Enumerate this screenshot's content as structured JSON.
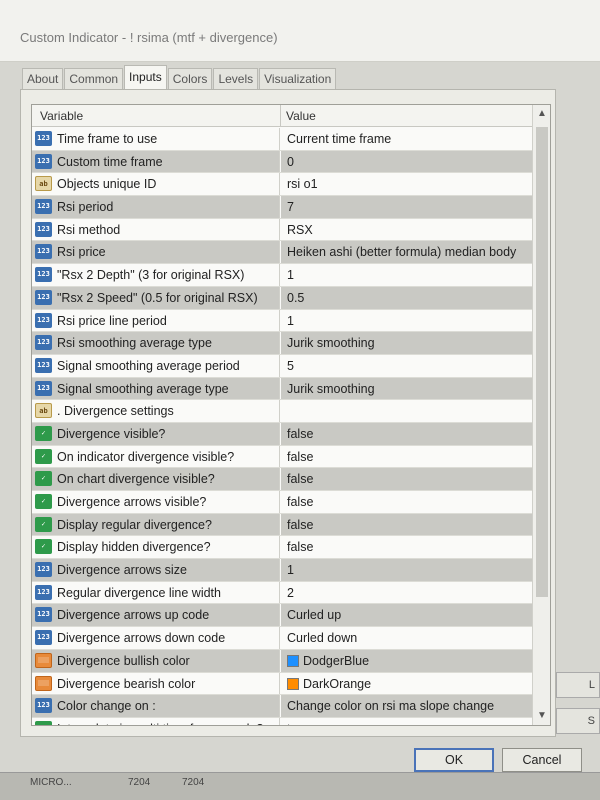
{
  "window": {
    "title": "Custom Indicator - ! rsima (mtf + divergence)"
  },
  "tabs": [
    {
      "label": "About"
    },
    {
      "label": "Common"
    },
    {
      "label": "Inputs"
    },
    {
      "label": "Colors"
    },
    {
      "label": "Levels"
    },
    {
      "label": "Visualization"
    }
  ],
  "grid": {
    "col_variable": "Variable",
    "col_value": "Value",
    "rows": [
      {
        "icon": "num",
        "variable": "Time frame to use",
        "value": "Current time frame",
        "highlight": false
      },
      {
        "icon": "num",
        "variable": "Custom time frame",
        "value": "0",
        "highlight": true
      },
      {
        "icon": "ab",
        "variable": "Objects unique ID",
        "value": "rsi o1",
        "highlight": false
      },
      {
        "icon": "num",
        "variable": "Rsi period",
        "value": "7",
        "highlight": true
      },
      {
        "icon": "num",
        "variable": "Rsi method",
        "value": "RSX",
        "highlight": false
      },
      {
        "icon": "num",
        "variable": "Rsi price",
        "value": "Heiken ashi (better formula) median body",
        "highlight": true
      },
      {
        "icon": "num",
        "variable": "\"Rsx 2 Depth\" (3 for original RSX)",
        "value": "1",
        "highlight": false
      },
      {
        "icon": "num",
        "variable": "\"Rsx 2 Speed\" (0.5 for original RSX)",
        "value": "0.5",
        "highlight": true
      },
      {
        "icon": "num",
        "variable": "Rsi price line period",
        "value": "1",
        "highlight": false
      },
      {
        "icon": "num",
        "variable": "Rsi smoothing average type",
        "value": "Jurik smoothing",
        "highlight": true
      },
      {
        "icon": "num",
        "variable": "Signal smoothing average period",
        "value": "5",
        "highlight": false
      },
      {
        "icon": "num",
        "variable": "Signal smoothing average type",
        "value": "Jurik smoothing",
        "highlight": true
      },
      {
        "icon": "ab",
        "variable": ". Divergence settings",
        "value": "",
        "highlight": false
      },
      {
        "icon": "bool",
        "variable": "Divergence visible?",
        "value": "false",
        "highlight": true
      },
      {
        "icon": "bool",
        "variable": "On indicator divergence visible?",
        "value": "false",
        "highlight": false
      },
      {
        "icon": "bool",
        "variable": "On chart divergence visible?",
        "value": "false",
        "highlight": true
      },
      {
        "icon": "bool",
        "variable": "Divergence arrows visible?",
        "value": "false",
        "highlight": false
      },
      {
        "icon": "bool",
        "variable": "Display regular divergence?",
        "value": "false",
        "highlight": true
      },
      {
        "icon": "bool",
        "variable": "Display hidden divergence?",
        "value": "false",
        "highlight": false
      },
      {
        "icon": "num",
        "variable": "Divergence arrows size",
        "value": "1",
        "highlight": true
      },
      {
        "icon": "num",
        "variable": "Regular divergence line width",
        "value": "2",
        "highlight": false
      },
      {
        "icon": "num",
        "variable": "Divergence arrows up code",
        "value": "Curled up",
        "highlight": true
      },
      {
        "icon": "num",
        "variable": "Divergence arrows down code",
        "value": "Curled down",
        "highlight": false
      },
      {
        "icon": "color",
        "variable": "Divergence bullish color",
        "value": "DodgerBlue",
        "swatch": "#1e90ff",
        "highlight": true
      },
      {
        "icon": "color",
        "variable": "Divergence bearish color",
        "value": "DarkOrange",
        "swatch": "#ff8c00",
        "highlight": false
      },
      {
        "icon": "num",
        "variable": "Color change on :",
        "value": "Change color on rsi ma slope change",
        "highlight": true
      },
      {
        "icon": "bool",
        "variable": "Interpolate in multi time frame mode?",
        "value": "true",
        "highlight": false
      }
    ]
  },
  "buttons": {
    "ok": "OK",
    "cancel": "Cancel"
  },
  "taskbar": {
    "item1": "MICRO...",
    "item2": "7204",
    "item3": "7204"
  }
}
